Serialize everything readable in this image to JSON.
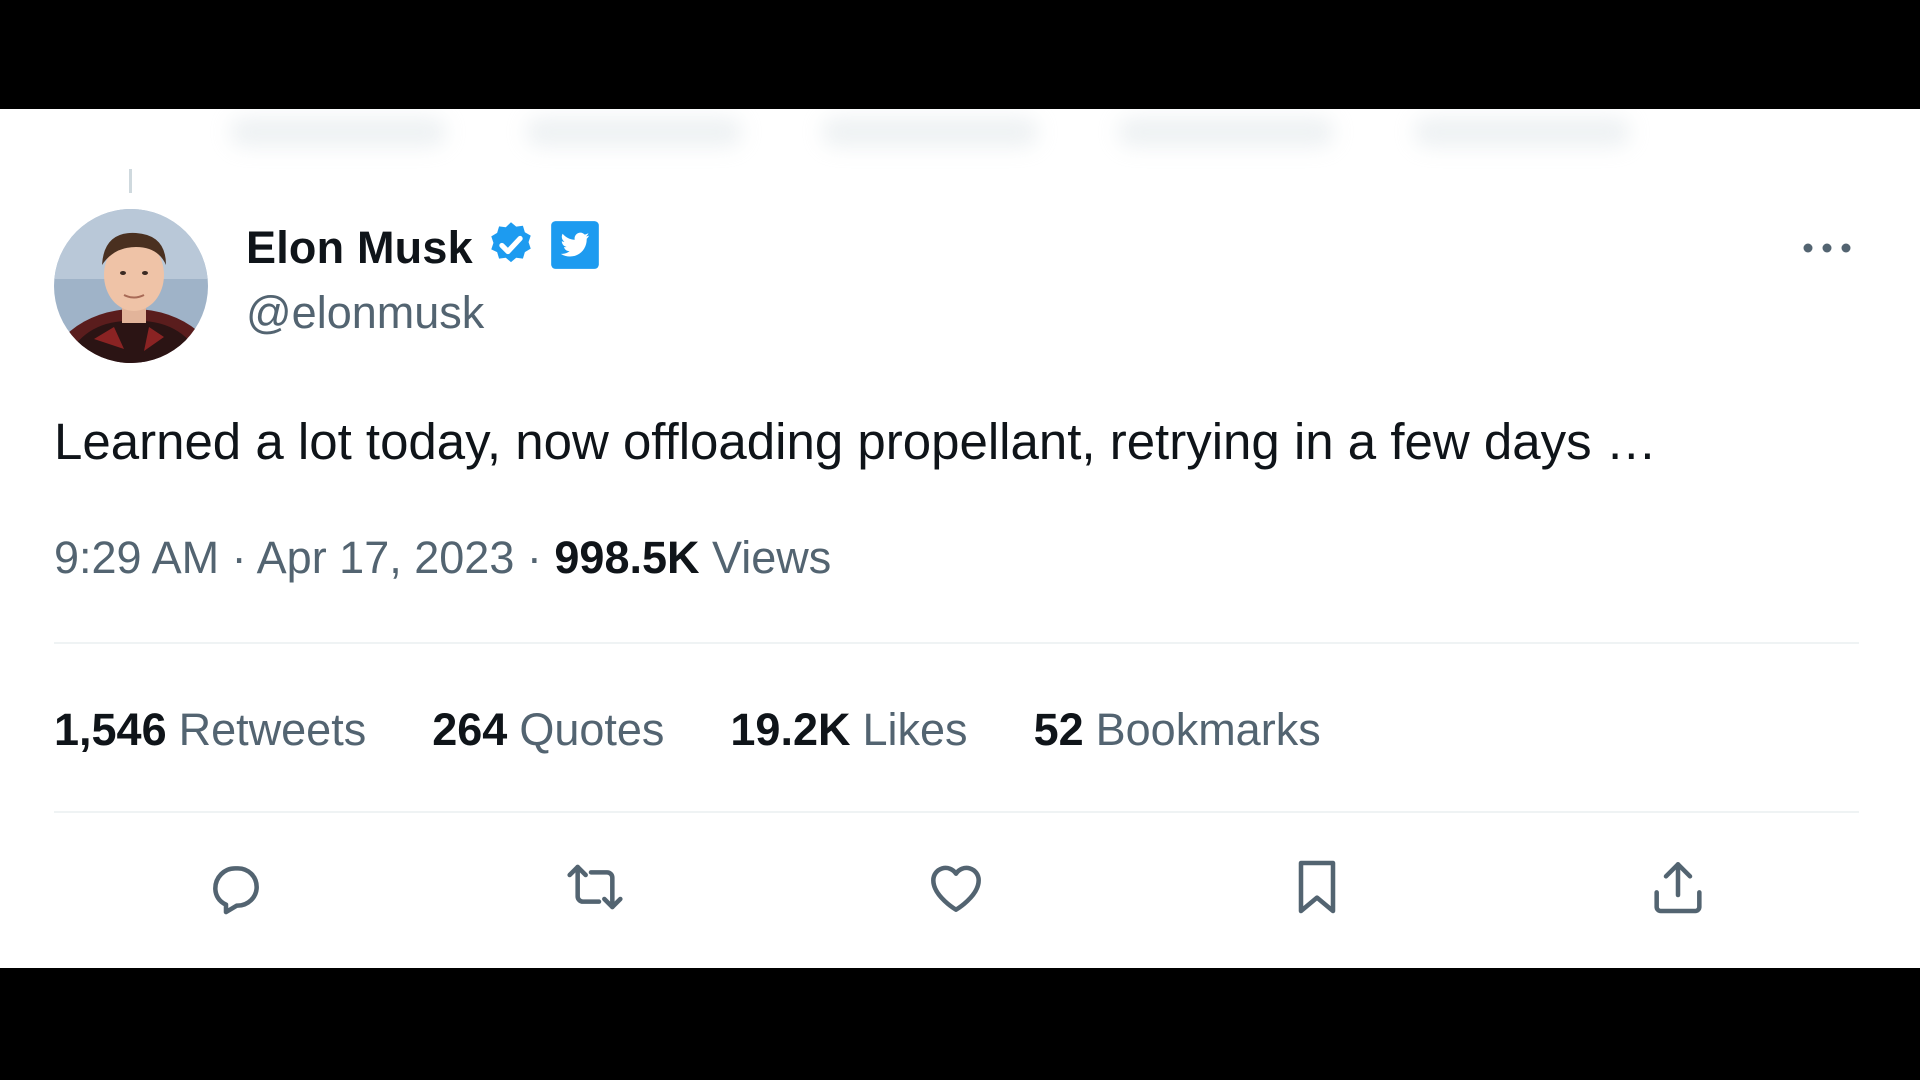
{
  "tweet": {
    "author": {
      "display_name": "Elon Musk",
      "handle": "@elonmusk",
      "verified_color": "#1d9bf0"
    },
    "text": "Learned a lot today, now offloading propellant, retrying in a few days …",
    "time": "9:29 AM",
    "separator": "·",
    "date": "Apr 17, 2023",
    "views_count": "998.5K",
    "views_label": "Views",
    "stats": [
      {
        "count": "1,546",
        "label": "Retweets"
      },
      {
        "count": "264",
        "label": "Quotes"
      },
      {
        "count": "19.2K",
        "label": "Likes"
      },
      {
        "count": "52",
        "label": "Bookmarks"
      }
    ],
    "actions": [
      "reply-icon",
      "retweet-icon",
      "like-icon",
      "bookmark-icon",
      "share-icon"
    ]
  },
  "colors": {
    "text_primary": "#0f1419",
    "text_secondary": "#536471",
    "accent": "#1d9bf0",
    "divider": "#eff3f4"
  }
}
